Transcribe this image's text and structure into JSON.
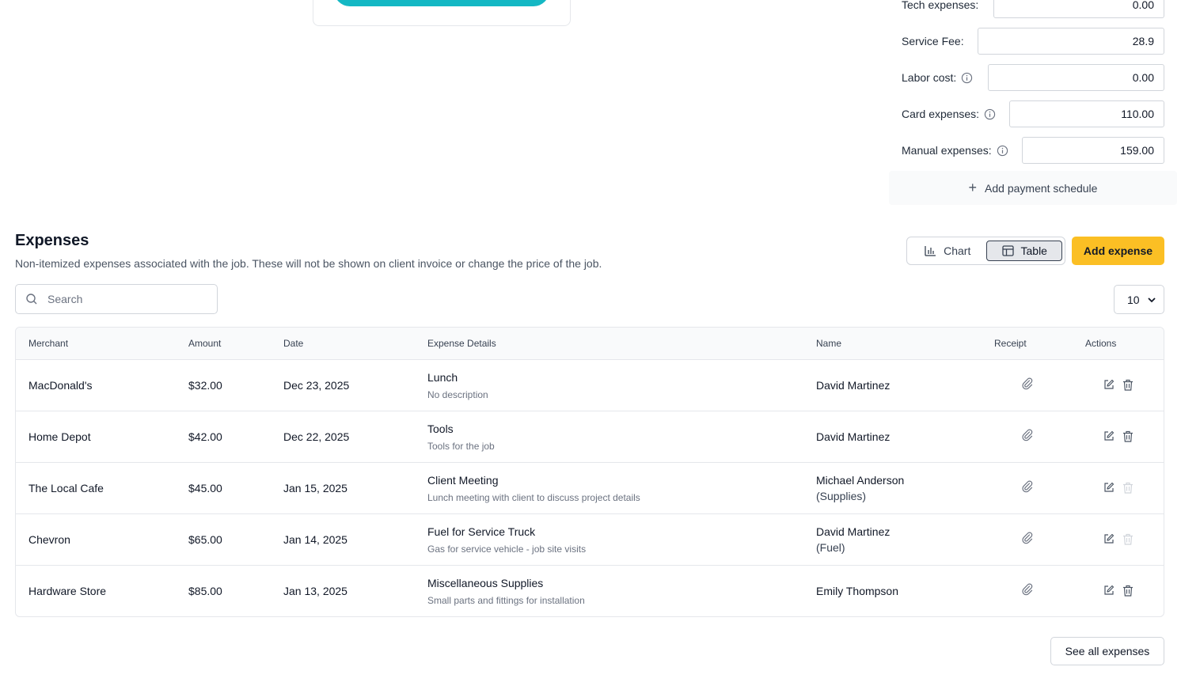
{
  "costs": {
    "tech_expenses": {
      "label": "Tech expenses:",
      "value": "0.00"
    },
    "service_fee": {
      "label": "Service Fee:",
      "value": "28.9"
    },
    "labor_cost": {
      "label": "Labor cost:",
      "value": "0.00"
    },
    "card_expenses": {
      "label": "Card expenses:",
      "value": "110.00"
    },
    "manual_expenses": {
      "label": "Manual expenses:",
      "value": "159.00"
    },
    "add_payment_schedule": "Add payment schedule"
  },
  "expenses": {
    "title": "Expenses",
    "description": "Non-itemized expenses associated with the job. These will not be shown on client invoice or change the price of the job.",
    "view_chart_label": "Chart",
    "view_table_label": "Table",
    "add_expense_label": "Add expense",
    "search_placeholder": "Search",
    "page_size": "10",
    "see_all_label": "See all expenses",
    "columns": {
      "merchant": "Merchant",
      "amount": "Amount",
      "date": "Date",
      "details": "Expense Details",
      "name": "Name",
      "receipt": "Receipt",
      "actions": "Actions"
    },
    "rows": [
      {
        "merchant": "MacDonald's",
        "amount": "$32.00",
        "date": "Dec 23, 2025",
        "title": "Lunch",
        "description": "No description",
        "name": "David Martinez",
        "name_note": "",
        "delete_enabled": true
      },
      {
        "merchant": "Home Depot",
        "amount": "$42.00",
        "date": "Dec 22, 2025",
        "title": "Tools",
        "description": "Tools for the job",
        "name": "David Martinez",
        "name_note": "",
        "delete_enabled": true
      },
      {
        "merchant": "The Local Cafe",
        "amount": "$45.00",
        "date": "Jan 15, 2025",
        "title": "Client Meeting",
        "description": "Lunch meeting with client to discuss project details",
        "name": "Michael Anderson",
        "name_note": "(Supplies)",
        "delete_enabled": false
      },
      {
        "merchant": "Chevron",
        "amount": "$65.00",
        "date": "Jan 14, 2025",
        "title": "Fuel for Service Truck",
        "description": "Gas for service vehicle - job site visits",
        "name": "David Martinez",
        "name_note": "(Fuel)",
        "delete_enabled": false
      },
      {
        "merchant": "Hardware Store",
        "amount": "$85.00",
        "date": "Jan 13, 2025",
        "title": "Miscellaneous Supplies",
        "description": "Small parts and fittings for installation",
        "name": "Emily Thompson",
        "name_note": "",
        "delete_enabled": true
      }
    ]
  },
  "colors": {
    "accent_yellow": "#fbbf24",
    "teal": "#14b8c4",
    "border": "#e5e7eb"
  }
}
